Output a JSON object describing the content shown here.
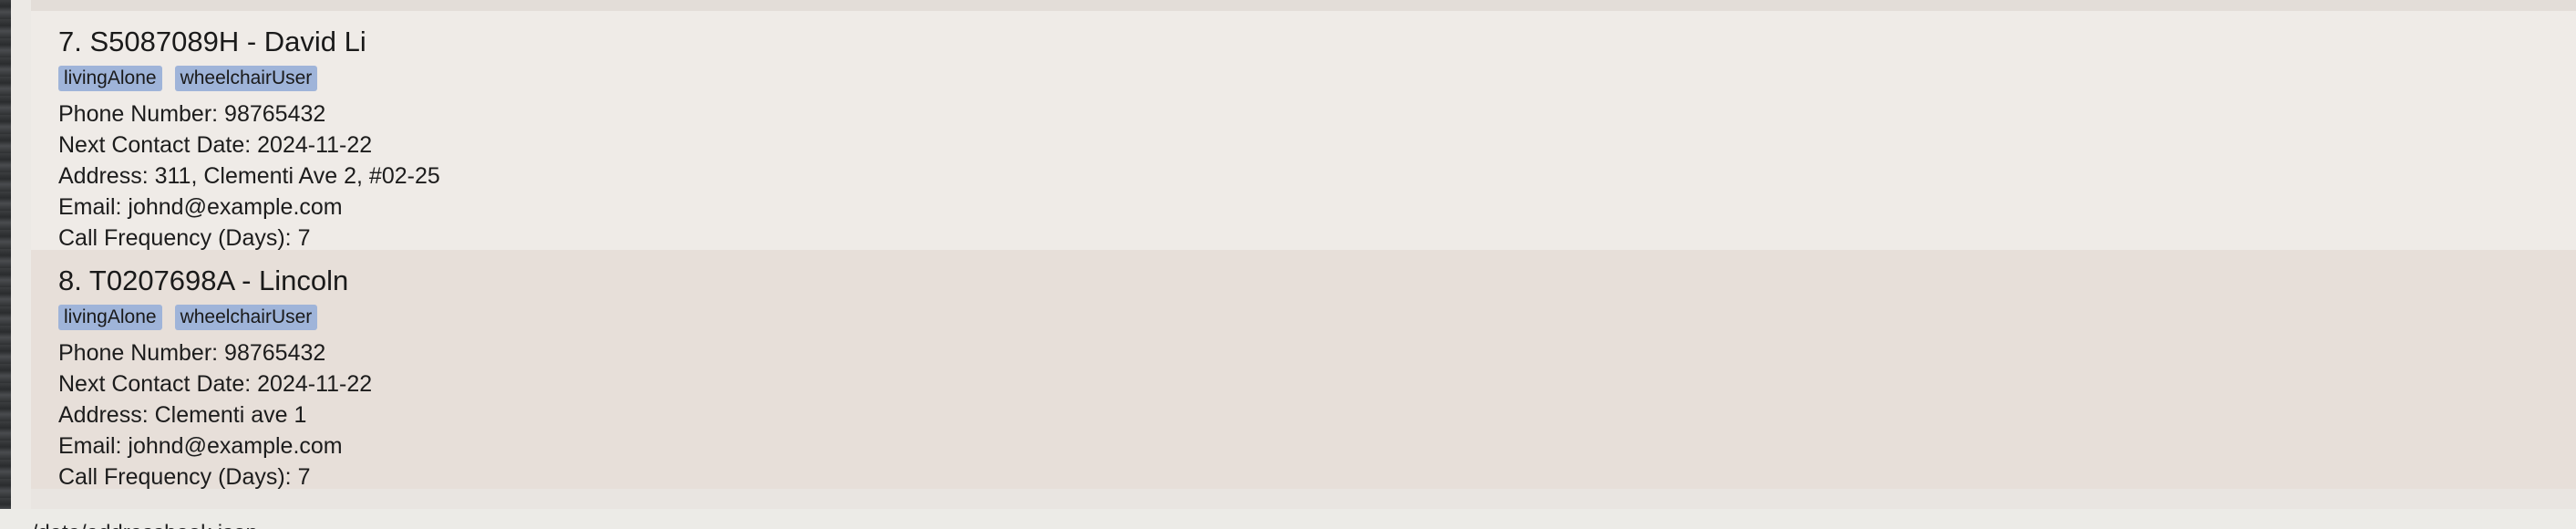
{
  "persons": [
    {
      "header": "7. S5087089H - David Li",
      "tags": [
        "livingAlone",
        "wheelchairUser"
      ],
      "phone": "Phone Number: 98765432",
      "next_contact": "Next Contact Date: 2024-11-22",
      "address": "Address: 311, Clementi Ave 2, #02-25",
      "email": "Email: johnd@example.com",
      "call_frequency": "Call Frequency (Days): 7"
    },
    {
      "header": "8. T0207698A - Lincoln",
      "tags": [
        "livingAlone",
        "wheelchairUser"
      ],
      "phone": "Phone Number: 98765432",
      "next_contact": "Next Contact Date: 2024-11-22",
      "address": "Address: Clementi ave 1",
      "email": "Email: johnd@example.com",
      "call_frequency": "Call Frequency (Days): 7"
    }
  ],
  "status_bar": {
    "text": "./data/addressbook.json"
  },
  "colors": {
    "tag_background": "#9fb4d9",
    "card_odd": "#efebe7",
    "card_even": "#e7dfd9"
  }
}
